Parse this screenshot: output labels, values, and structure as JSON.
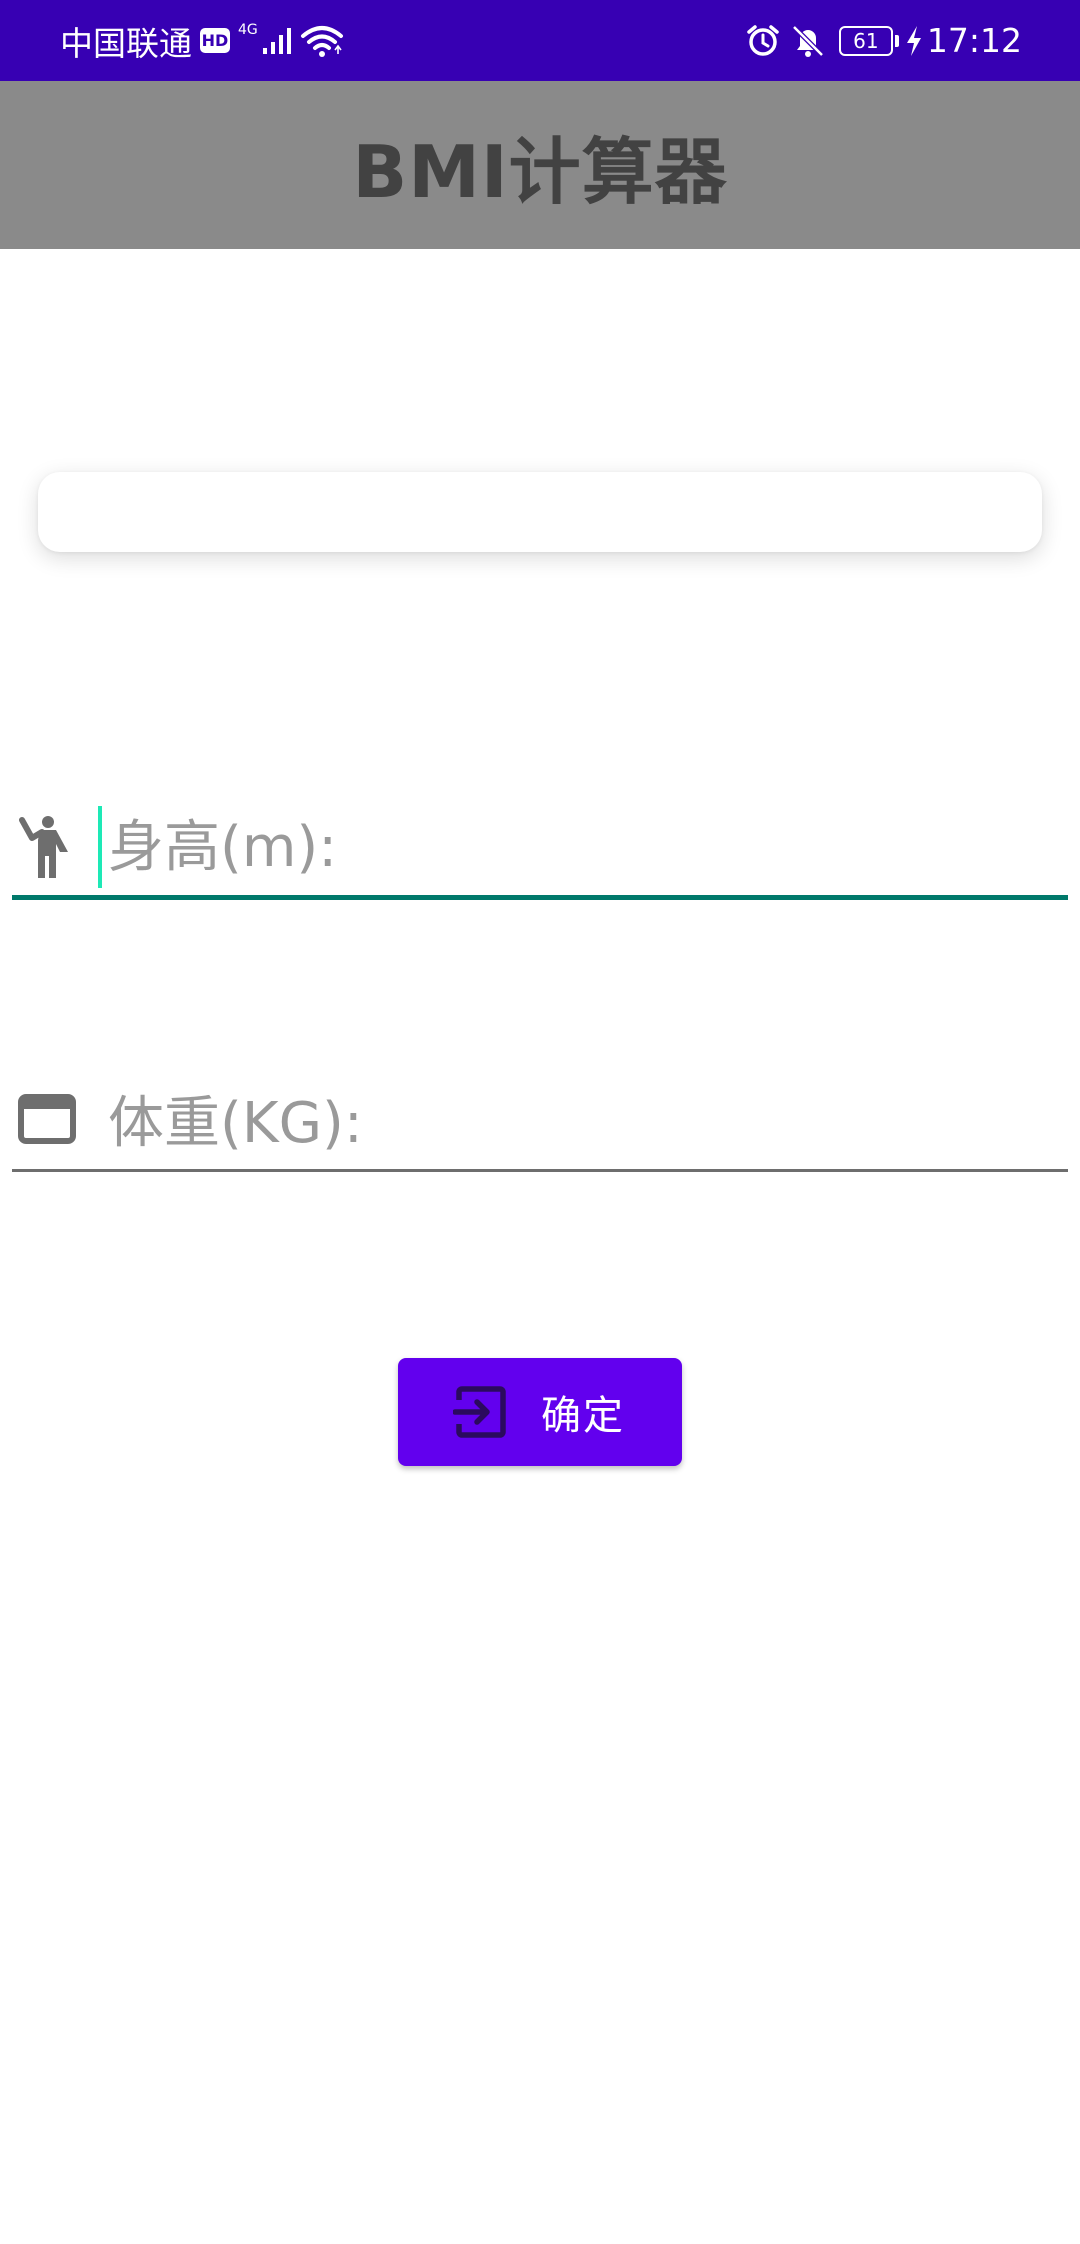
{
  "status_bar": {
    "carrier": "中国联通",
    "hd_badge": "HD",
    "network_type": "4G",
    "battery_level": "61",
    "time": "17:12",
    "icons": [
      "signal-icon",
      "wifi-icon",
      "alarm-icon",
      "bell-off-icon",
      "battery-icon",
      "charging-bolt-icon"
    ],
    "background": "#3700b3"
  },
  "app_bar": {
    "title": "BMI计算器",
    "background": "#8a8a8a"
  },
  "result_card": {
    "text": ""
  },
  "form": {
    "height_field": {
      "icon": "person-waving-icon",
      "placeholder": "身高(m):",
      "value": "",
      "focused": true,
      "accent": "#00796b"
    },
    "weight_field": {
      "icon": "window-icon",
      "placeholder": "体重(KG):",
      "value": "",
      "focused": false
    },
    "confirm_button": {
      "icon": "exit-to-app-icon",
      "label": "确定",
      "background": "#6200ee"
    }
  }
}
